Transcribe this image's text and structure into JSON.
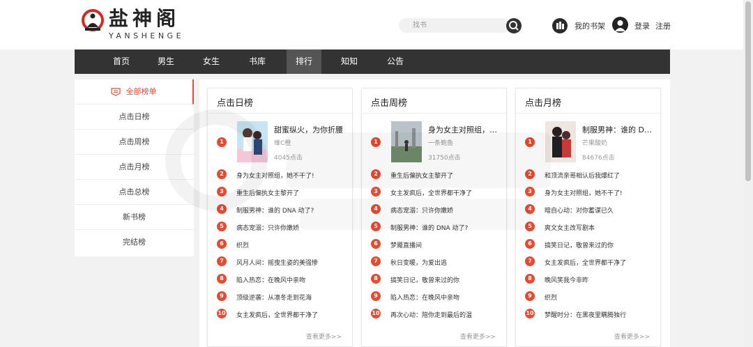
{
  "header": {
    "logo_title": "盐神阁",
    "logo_sub": "YANSHENGE",
    "search_placeholder": "找书",
    "bookshelf": "我的书架",
    "login": "登录",
    "register": "注册"
  },
  "nav": [
    "首页",
    "男生",
    "女生",
    "书库",
    "排行",
    "知知",
    "公告"
  ],
  "nav_active": "排行",
  "sidebar": [
    "全部榜单",
    "点击日榜",
    "点击周榜",
    "点击月榜",
    "点击总榜",
    "新书榜",
    "完结榜"
  ],
  "panels": [
    {
      "title": "点击日榜",
      "top": {
        "title": "甜蜜纵火，为你折腰",
        "author": "维C橙",
        "clicks": "4045点击"
      },
      "items": [
        "身为女主对照组，她不干了!",
        "重生后偏执女主黎开了",
        "制服男神：谁的 DNA 动了?",
        "病态宠溺：只许你嫩娇",
        "织烈",
        "风月人间：摇曳生姿的美强惨",
        "陷入热恋：在晚风中亲吻",
        "顶级逆袭：从凛冬走到花海",
        "女主发疯后，全世界都干净了"
      ],
      "more": "查看更多>>"
    },
    {
      "title": "点击周榜",
      "top": {
        "title": "身为女主对照组，她不干了!",
        "author": "一条鲍鱼",
        "clicks": "31750点击"
      },
      "items": [
        "重生后偏执女主黎开了",
        "女主发疯后，全世界都干净了",
        "病态宠溺：只许你嫩娇",
        "制服男神：谁的 DNA 动了?",
        "梦魇直播间",
        "秋日变暖，为爱出逃",
        "搞笑日记，敬曾来过的你",
        "陷入热恋：在晚风中亲吻",
        "再次心动：陪你走到最后的温"
      ],
      "more": "查看更多>>"
    },
    {
      "title": "点击月榜",
      "top": {
        "title": "制服男神：谁的 DNA 动了?",
        "author": "芒果酸奶",
        "clicks": "84676点击"
      },
      "items": [
        "和顶流亲哥相认后我爆红了",
        "身为女主对照组，她不干了!",
        "暗自心动：对你蓄谋已久",
        "爽文女主改写剧本",
        "搞笑日记，敬曾来过的你",
        "女主发疯后，全世界都干净了",
        "晚风笑我今非昨",
        "织烈",
        "梦醒时分：在黑夜里瞒腾独行"
      ],
      "more": "查看更多>>"
    }
  ],
  "colors": {
    "accent": "#e84a2f",
    "nav_bg": "#333333",
    "nav_active": "#555555"
  }
}
